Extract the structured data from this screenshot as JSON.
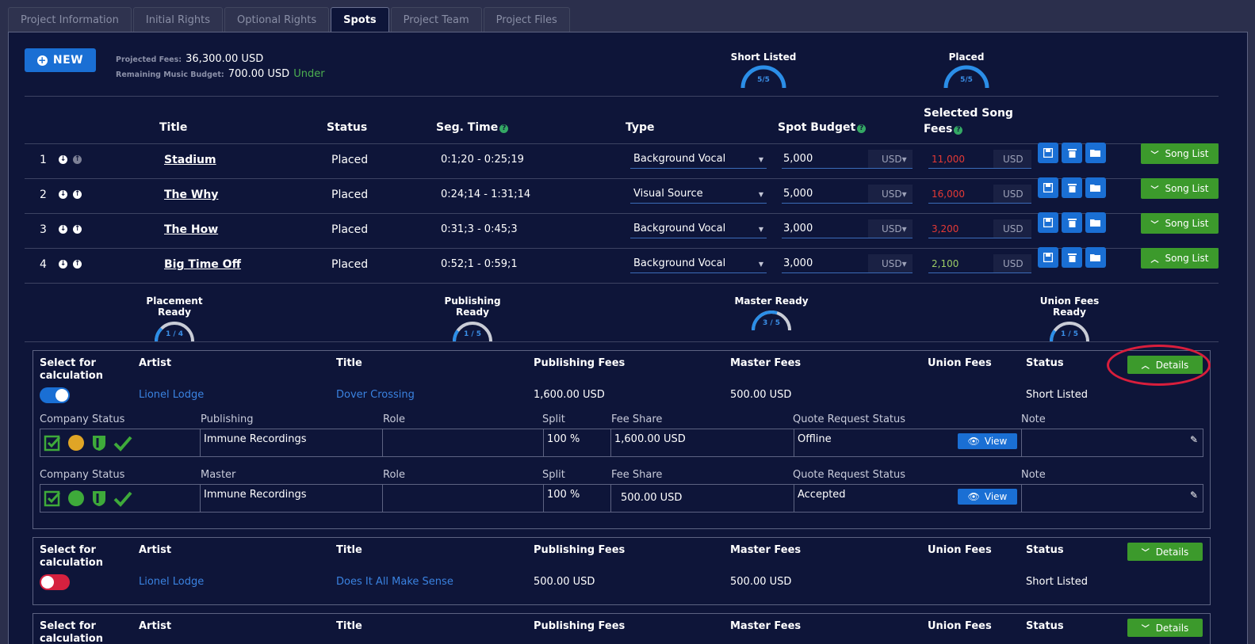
{
  "tabs": [
    "Project Information",
    "Initial Rights",
    "Optional Rights",
    "Spots",
    "Project Team",
    "Project Files"
  ],
  "toolbar": {
    "new_label": "NEW",
    "projected_fees_label": "Projected Fees:",
    "projected_fees_value": "36,300.00 USD",
    "remaining_budget_label": "Remaining Music Budget:",
    "remaining_budget_value": "700.00 USD",
    "remaining_budget_status": "Under"
  },
  "top_gauges": [
    {
      "title": "Short Listed",
      "value": "5/5",
      "fraction": 1.0
    },
    {
      "title": "Placed",
      "value": "5/5",
      "fraction": 1.0
    }
  ],
  "spots_table": {
    "headers": {
      "title": "Title",
      "status": "Status",
      "seg_time": "Seg. Time",
      "type": "Type",
      "spot_budget": "Spot Budget",
      "selected_fees_1": "Selected Song",
      "selected_fees_2": "Fees"
    },
    "rows": [
      {
        "num": "1",
        "title": "Stadium",
        "status": "Placed",
        "seg": "0:1;20 - 0:25;19",
        "type": "Background Vocal",
        "budget": "5,000",
        "currency": "USD",
        "fee": "11,000",
        "fee_currency": "USD",
        "song_list": "Song List"
      },
      {
        "num": "2",
        "title": "The Why",
        "status": "Placed",
        "seg": "0:24;14 - 1:31;14",
        "type": "Visual Source",
        "budget": "5,000",
        "currency": "USD",
        "fee": "16,000",
        "fee_currency": "USD",
        "song_list": "Song List"
      },
      {
        "num": "3",
        "title": "The How",
        "status": "Placed",
        "seg": "0:31;3 - 0:45;3",
        "type": "Background Vocal",
        "budget": "3,000",
        "currency": "USD",
        "fee": "3,200",
        "fee_currency": "USD",
        "song_list": "Song List"
      },
      {
        "num": "4",
        "title": "Big Time Off",
        "status": "Placed",
        "seg": "0:52;1 - 0:59;1",
        "type": "Background Vocal",
        "budget": "3,000",
        "currency": "USD",
        "fee": "2,100",
        "fee_currency": "USD",
        "song_list": "Song List"
      }
    ]
  },
  "ready_gauges": [
    {
      "title": "Placement Ready",
      "value": "1 / 4",
      "fraction": 0.25
    },
    {
      "title": "Publishing Ready",
      "value": "1 / 5",
      "fraction": 0.2
    },
    {
      "title": "Master Ready",
      "value": "3 / 5",
      "fraction": 0.6
    },
    {
      "title": "Union Fees Ready",
      "value": "1 / 5",
      "fraction": 0.2
    }
  ],
  "card_headers": {
    "select_1": "Select for",
    "select_2": "calculation",
    "artist": "Artist",
    "title": "Title",
    "publishing_fees": "Publishing Fees",
    "master_fees": "Master Fees",
    "union_fees": "Union Fees",
    "status": "Status",
    "details": "Details"
  },
  "songs": [
    {
      "artist": "Lionel Lodge",
      "title": "Dover Crossing",
      "publishing_fees": "1,600.00 USD",
      "master_fees": "500.00 USD",
      "status": "Short Listed",
      "selected": true
    },
    {
      "artist": "Lionel Lodge",
      "title": "Does It All Make Sense",
      "publishing_fees": "500.00 USD",
      "master_fees": "500.00 USD",
      "status": "Short Listed",
      "selected": false
    }
  ],
  "detail_headers": {
    "company_status": "Company Status",
    "publishing": "Publishing",
    "master": "Master",
    "role": "Role",
    "split": "Split",
    "fee_share": "Fee Share",
    "quote_status": "Quote Request Status",
    "note": "Note"
  },
  "details": {
    "publishing": {
      "company": "Immune Recordings",
      "role": "",
      "split": "100 %",
      "fee_share": "1,600.00 USD",
      "quote_status": "Offline",
      "view": "View",
      "note": ""
    },
    "master": {
      "company": "Immune Recordings",
      "role": "",
      "split": "100 %",
      "fee_share": "500.00 USD",
      "quote_status": "Accepted",
      "view": "View",
      "note": ""
    }
  },
  "colors": {
    "accent_blue": "#1a6fd4",
    "green": "#3c9a2c",
    "red": "#e53935",
    "toggle_off": "#d6213f",
    "gold": "#e0a526",
    "panel_bg": "#0e1539"
  }
}
